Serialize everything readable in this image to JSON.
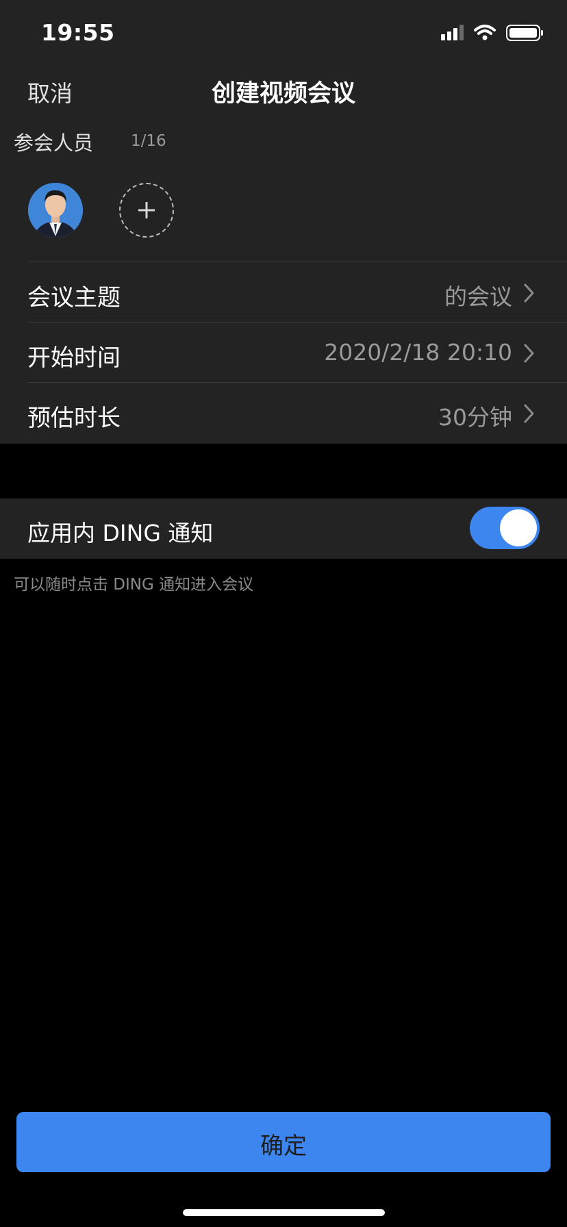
{
  "status_bar": {
    "time": "19:55",
    "icons": [
      "signal-icon",
      "wifi-icon",
      "battery-icon"
    ]
  },
  "nav": {
    "cancel_label": "取消",
    "title": "创建视频会议"
  },
  "participants": {
    "label": "参会人员",
    "count": "1/16"
  },
  "form_rows": {
    "topic": {
      "label": "会议主题",
      "value": "的会议"
    },
    "start_time": {
      "label": "开始时间",
      "value": "2020/2/18 20:10"
    },
    "duration": {
      "label": "预估时长",
      "value": "30分钟"
    }
  },
  "ding": {
    "label": "应用内 DING 通知",
    "enabled": true,
    "hint": "可以随时点击 DING 通知进入会议"
  },
  "confirm_label": "确定",
  "colors": {
    "accent": "#3d86f0",
    "panel": "#232323",
    "background": "#000000"
  }
}
